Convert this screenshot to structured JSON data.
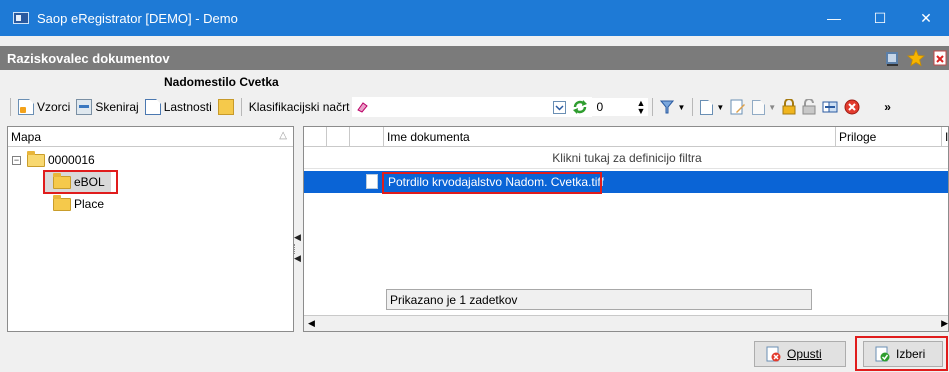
{
  "window": {
    "title": "Saop eRegistrator [DEMO] - Demo",
    "minimize_glyph": "—",
    "maximize_glyph": "☐",
    "close_glyph": "✕"
  },
  "header": {
    "title": "Raziskovalec dokumentov"
  },
  "document": {
    "title": "Nadomestilo Cvetka"
  },
  "toolbar": {
    "vzorci_label": "Vzorci",
    "skeniraj_label": "Skeniraj",
    "lastnosti_label": "Lastnosti",
    "klasifikacijski_label": "Klasifikacijski načrt",
    "counter_value": "0"
  },
  "tree": {
    "column_header": "Mapa",
    "root_expander": "−",
    "root_label": "0000016",
    "items": [
      {
        "label": "eBOL"
      },
      {
        "label": "Place"
      }
    ]
  },
  "grid": {
    "col_name": "Ime dokumenta",
    "col_priloge": "Priloge",
    "col_extra": "I",
    "filter_text": "Klikni tukaj za definicijo filtra",
    "rows": [
      {
        "name": "Potrdilo krvodajalstvo Nadom. Cvetka.tiff"
      }
    ],
    "footer": "Prikazano je 1 zadetkov"
  },
  "buttons": {
    "opusti": "Opusti",
    "izberi": "Izberi"
  },
  "colors": {
    "titlebar": "#1e7ad6",
    "header": "#7b7b7b",
    "selection": "#0a64d6",
    "highlight": "#e01c1c"
  }
}
